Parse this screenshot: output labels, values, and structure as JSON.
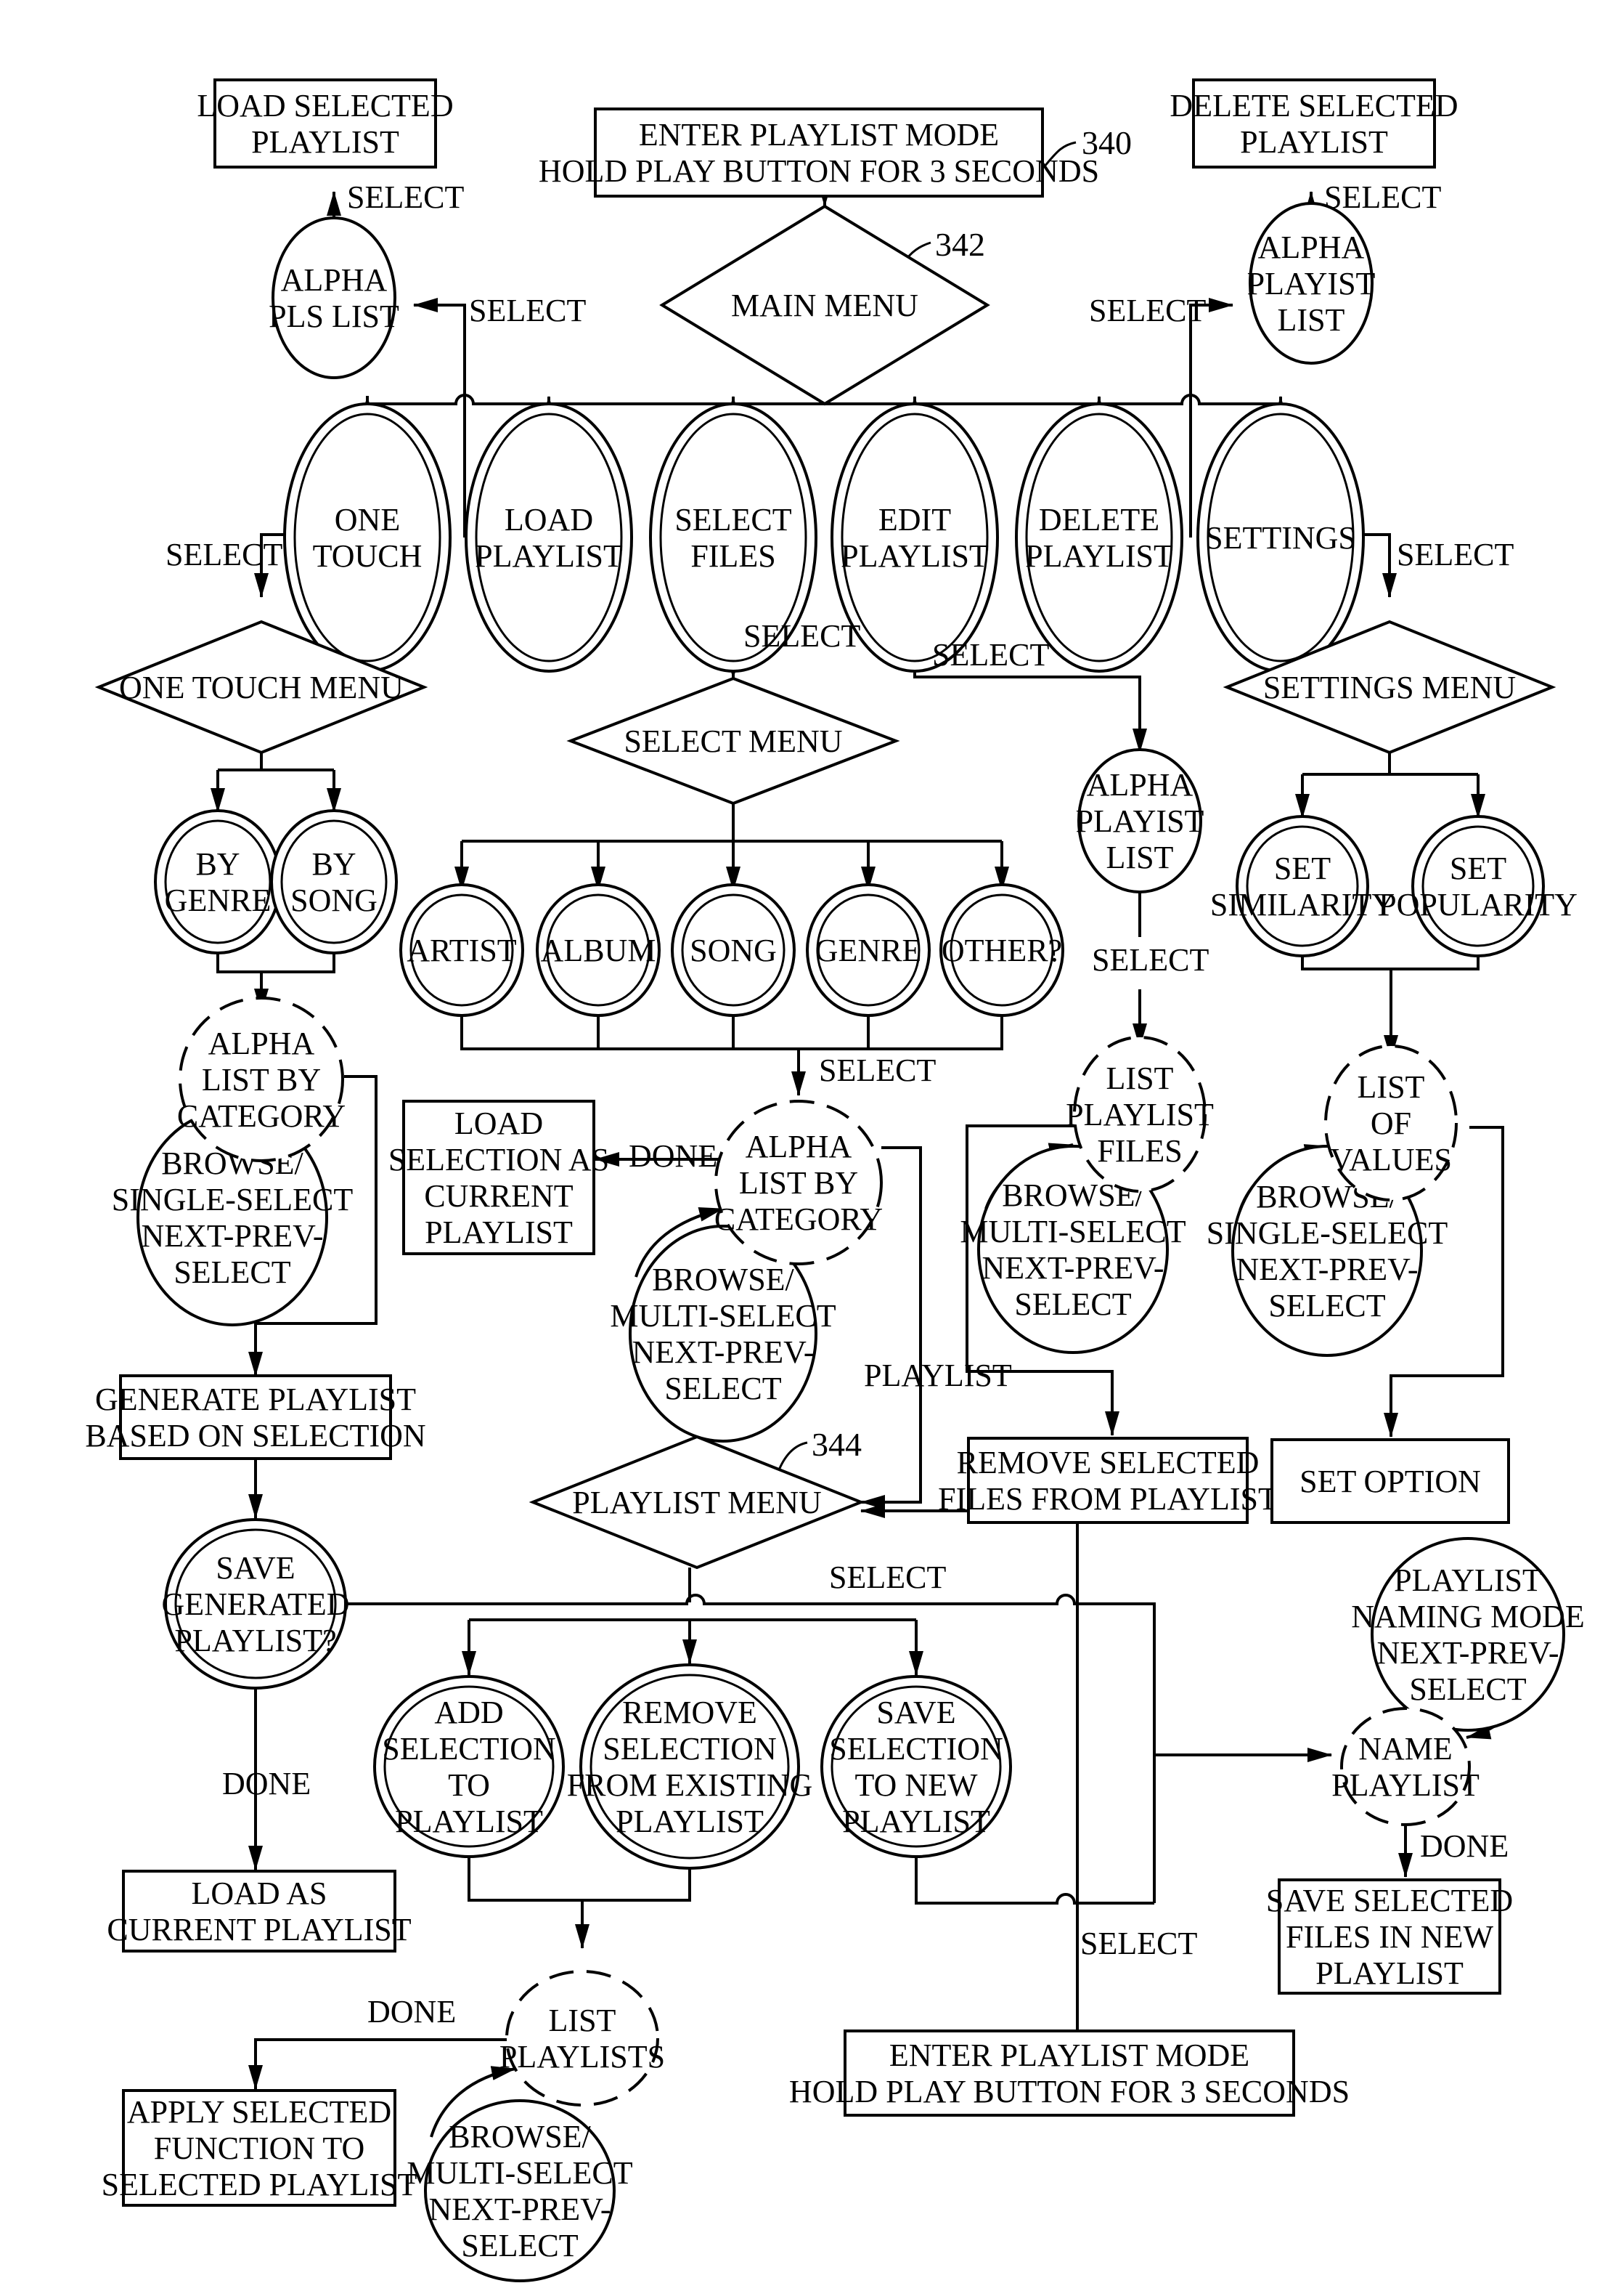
{
  "figure": {
    "refs": {
      "top_entry": "340",
      "main_menu": "342",
      "playlist_menu": "344"
    }
  },
  "boxes": {
    "load_selected_playlist": [
      "LOAD SELECTED",
      "PLAYLIST"
    ],
    "enter_playlist_mode_top": [
      "ENTER PLAYLIST MODE",
      "HOLD PLAY BUTTON FOR 3 SECONDS"
    ],
    "delete_selected_playlist": [
      "DELETE SELECTED",
      "PLAYLIST"
    ],
    "load_selection_as_current": [
      "LOAD",
      "SELECTION AS",
      "CURRENT",
      "PLAYLIST"
    ],
    "generate_playlist": [
      "GENERATE PLAYLIST",
      "BASED ON SELECTION"
    ],
    "remove_selected_files": [
      "REMOVE SELECTED",
      "FILES FROM PLAYLIST"
    ],
    "set_option": [
      "SET OPTION"
    ],
    "load_as_current": [
      "LOAD AS",
      "CURRENT PLAYLIST"
    ],
    "apply_selected_function": [
      "APPLY SELECTED",
      "FUNCTION TO",
      "SELECTED PLAYLIST"
    ],
    "save_selected_files": [
      "SAVE SELECTED",
      "FILES IN NEW",
      "PLAYLIST"
    ],
    "enter_playlist_mode_bottom": [
      "ENTER PLAYLIST MODE",
      "HOLD PLAY BUTTON FOR 3 SECONDS"
    ]
  },
  "diamonds": {
    "main_menu": "MAIN MENU",
    "one_touch_menu": "ONE TOUCH MENU",
    "select_menu": "SELECT MENU",
    "settings_menu": "SETTINGS MENU",
    "playlist_menu": "PLAYLIST MENU"
  },
  "main_options": [
    [
      "ONE",
      "TOUCH"
    ],
    [
      "LOAD",
      "PLAYLIST"
    ],
    [
      "SELECT",
      "FILES"
    ],
    [
      "EDIT",
      "PLAYLIST"
    ],
    [
      "DELETE",
      "PLAYLIST"
    ],
    [
      "SETTINGS"
    ]
  ],
  "one_touch_options": [
    [
      "BY",
      "GENRE"
    ],
    [
      "BY",
      "SONG"
    ]
  ],
  "select_options": [
    [
      "ARTIST"
    ],
    [
      "ALBUM"
    ],
    [
      "SONG"
    ],
    [
      "GENRE"
    ],
    [
      "OTHER?"
    ]
  ],
  "settings_options": [
    [
      "SET",
      "SIMILARITY"
    ],
    [
      "SET",
      "POPULARITY"
    ]
  ],
  "playlist_options": [
    [
      "ADD",
      "SELECTION",
      "TO",
      "PLAYLIST"
    ],
    [
      "REMOVE",
      "SELECTION",
      "FROM EXISTING",
      "PLAYLIST"
    ],
    [
      "SAVE",
      "SELECTION",
      "TO NEW",
      "PLAYLIST"
    ]
  ],
  "save_generated": [
    "SAVE",
    "GENERATED",
    "PLAYLIST?"
  ],
  "circles": {
    "alpha_pls_list": [
      "ALPHA",
      "PLS LIST"
    ],
    "alpha_playist_list_top": [
      "ALPHA",
      "PLAYIST",
      "LIST"
    ],
    "alpha_playist_list_edit": [
      "ALPHA",
      "PLAYIST",
      "LIST"
    ],
    "browse_single_onetouch": [
      "BROWSE/",
      "SINGLE-SELECT",
      "NEXT-PREV-",
      "SELECT"
    ],
    "browse_multi_select": [
      "BROWSE/",
      "MULTI-SELECT",
      "NEXT-PREV-",
      "SELECT"
    ],
    "browse_multi_edit": [
      "BROWSE/",
      "MULTI-SELECT",
      "NEXT-PREV-",
      "SELECT"
    ],
    "browse_single_settings": [
      "BROWSE/",
      "SINGLE-SELECT",
      "NEXT-PREV-",
      "SELECT"
    ],
    "browse_multi_lists": [
      "BROWSE/",
      "MULTI-SELECT",
      "NEXT-PREV-",
      "SELECT"
    ],
    "naming_mode": [
      "PLAYLIST",
      "NAMING MODE",
      "NEXT-PREV-",
      "SELECT"
    ]
  },
  "dashed": {
    "alpha_list_onetouch": [
      "ALPHA",
      "LIST BY",
      "CATEGORY"
    ],
    "alpha_list_select": [
      "ALPHA",
      "LIST BY",
      "CATEGORY"
    ],
    "list_playlist_files": [
      "LIST",
      "PLAYLIST",
      "FILES"
    ],
    "list_of_values": [
      "LIST",
      "OF",
      "VALUES"
    ],
    "list_playlists": [
      "LIST",
      "PLAYLISTS"
    ],
    "name_playlist": [
      "NAME",
      "PLAYLIST"
    ]
  },
  "labels": {
    "select": "SELECT",
    "done": "DONE",
    "playlist": "PLAYLIST"
  }
}
